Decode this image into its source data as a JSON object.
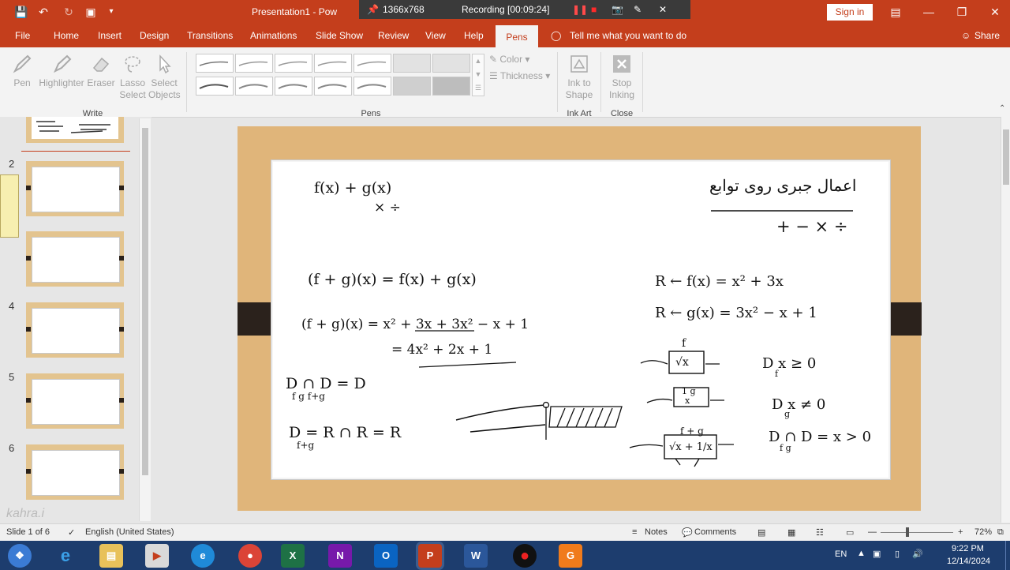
{
  "titlebar": {
    "doc_title": "Presentation1 - Pow",
    "resolution": "1366x768",
    "recording": "Recording [00:09:24]",
    "sign_in": "Sign in"
  },
  "menu": {
    "file": "File",
    "tabs": [
      "Home",
      "Insert",
      "Design",
      "Transitions",
      "Animations",
      "Slide Show",
      "Review",
      "View",
      "Help"
    ],
    "active_tab": "Pens",
    "tell_me": "Tell me what you want to do",
    "share": "Share"
  },
  "ribbon": {
    "write": {
      "pen": "Pen",
      "highlighter": "Highlighter",
      "eraser": "Eraser",
      "lasso_1": "Lasso",
      "lasso_2": "Select",
      "select_1": "Select",
      "select_2": "Objects",
      "group": "Write"
    },
    "pens_group": "Pens",
    "color": "Color",
    "thickness": "Thickness",
    "ink_to_shape_1": "Ink to",
    "ink_to_shape_2": "Shape",
    "ink_art": "Ink Art",
    "stop_inking_1": "Stop",
    "stop_inking_2": "Inking",
    "close": "Close"
  },
  "thumbnails": {
    "numbers": [
      "2",
      "4",
      "5",
      "6"
    ]
  },
  "slide": {
    "title_fa": "اعمال جبری روی توابع",
    "ops_header": "+ − × ÷",
    "line1": "f(x)   +   g(x)",
    "line1_ops": "×  ÷",
    "eq1": "(f + g)(x) = f(x) + g(x)",
    "eq2": "(f + g)(x) = x² + 3x + 3x² − x + 1",
    "eq3": "= 4x² + 2x + 1",
    "domain1": "D  ∩ D  = D",
    "domain1_sub": "f      g      f+g",
    "domain2": "D     = R ∩ R = R",
    "domain2_sub": "f+g",
    "f_def": "R ← f(x) = x² + 3x",
    "g_def": "R ← g(x) = 3x² − x + 1",
    "df": "D      x ≥ 0",
    "df_sub": "f",
    "dg": "D      x ≠ 0",
    "dg_sub": "g",
    "dfg": "D  ∩ D  = x > 0",
    "dfg_sub": "f      g",
    "box1_top": "f",
    "box1_in": "√x",
    "box2_top": "1 g",
    "box2_in": "x",
    "box3_top": "f + g",
    "box3_in": "√x + 1/x"
  },
  "status": {
    "slide_of": "Slide 1 of 6",
    "language": "English (United States)",
    "notes": "Notes",
    "comments": "Comments",
    "zoom": "72%"
  },
  "taskbar": {
    "lang": "EN",
    "time": "9:22 PM",
    "date": "12/14/2024"
  },
  "watermark": "kahra.i",
  "colors": {
    "accent": "#c43e1c",
    "taskbar": "#1d3d6e",
    "slide_frame": "#e0b57a"
  }
}
